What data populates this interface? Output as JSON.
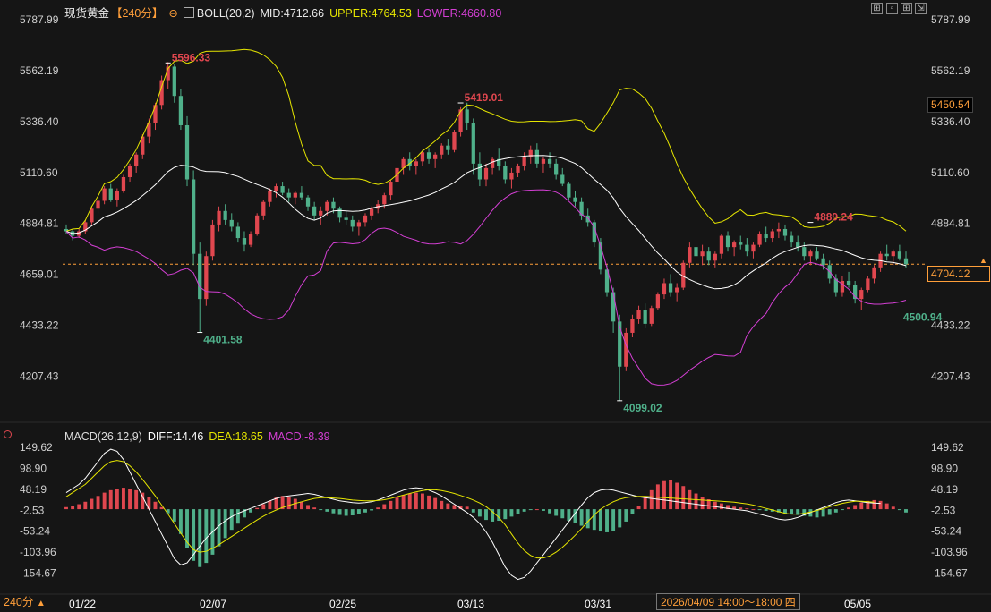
{
  "header": {
    "title": "现货黄金",
    "period": "【240分】",
    "boll_label": "BOLL(20,2)",
    "mid": "MID:4712.66",
    "upper": "UPPER:4764.53",
    "lower": "LOWER:4660.80"
  },
  "macd_header": {
    "label": "MACD(26,12,9)",
    "diff": "DIFF:14.46",
    "dea": "DEA:18.65",
    "macd": "MACD:-8.39"
  },
  "price_tags": {
    "crosshair_price": "5450.54",
    "last_price": "4704.12"
  },
  "bottom_bar": {
    "period": "240分",
    "crosshair_time": "2026/04/09 14:00～18:00 四"
  },
  "colors": {
    "up": "#e0474f",
    "down": "#4fb08a",
    "mid": "#ffffff",
    "upper": "#e6e600",
    "lower": "#d43fd4",
    "dea": "#e6e600",
    "background": "#151515",
    "last_price": "#ff9f3a"
  },
  "chart_data": [
    {
      "type": "candlestick",
      "title": "现货黄金",
      "y_ticks": [
        "5787.99",
        "5562.19",
        "5336.40",
        "5110.60",
        "4884.81",
        "4659.01",
        "4433.22",
        "4207.43"
      ],
      "ylim": [
        4120,
        5830
      ],
      "x_ticks": [
        "01/22",
        "02/07",
        "02/25",
        "03/13",
        "03/31",
        "05/05"
      ],
      "annotations": [
        {
          "text": "5596.33",
          "value": 5596.33,
          "kind": "high"
        },
        {
          "text": "4401.58",
          "value": 4401.58,
          "kind": "low"
        },
        {
          "text": "5419.01",
          "value": 5419.01,
          "kind": "high"
        },
        {
          "text": "4099.02",
          "value": 4099.02,
          "kind": "low"
        },
        {
          "text": "4889.24",
          "value": 4889.24,
          "kind": "high"
        },
        {
          "text": "4500.94",
          "value": 4500.94,
          "kind": "low"
        }
      ],
      "last_price": 4704.12,
      "points": [
        [
          4860,
          4880,
          4840,
          4850
        ],
        [
          4850,
          4860,
          4810,
          4830
        ],
        [
          4830,
          4860,
          4820,
          4850
        ],
        [
          4850,
          4900,
          4840,
          4890
        ],
        [
          4890,
          4960,
          4880,
          4950
        ],
        [
          4950,
          5000,
          4930,
          4985
        ],
        [
          4985,
          5050,
          4970,
          5040
        ],
        [
          5040,
          5060,
          4980,
          4990
        ],
        [
          4990,
          5040,
          4960,
          5030
        ],
        [
          5030,
          5100,
          5020,
          5090
        ],
        [
          5090,
          5150,
          5070,
          5140
        ],
        [
          5140,
          5200,
          5110,
          5190
        ],
        [
          5190,
          5280,
          5170,
          5270
        ],
        [
          5270,
          5350,
          5240,
          5330
        ],
        [
          5330,
          5420,
          5300,
          5410
        ],
        [
          5410,
          5540,
          5390,
          5520
        ],
        [
          5520,
          5600,
          5480,
          5580
        ],
        [
          5580,
          5590,
          5420,
          5450
        ],
        [
          5450,
          5480,
          5300,
          5320
        ],
        [
          5320,
          5360,
          5050,
          5080
        ],
        [
          5080,
          5120,
          4700,
          4750
        ],
        [
          4750,
          4800,
          4400,
          4550
        ],
        [
          4550,
          4760,
          4520,
          4740
        ],
        [
          4740,
          4900,
          4720,
          4880
        ],
        [
          4880,
          4960,
          4850,
          4940
        ],
        [
          4940,
          4970,
          4880,
          4900
        ],
        [
          4900,
          4930,
          4850,
          4870
        ],
        [
          4870,
          4890,
          4800,
          4820
        ],
        [
          4820,
          4850,
          4760,
          4790
        ],
        [
          4790,
          4850,
          4780,
          4840
        ],
        [
          4840,
          4930,
          4830,
          4920
        ],
        [
          4920,
          4990,
          4900,
          4980
        ],
        [
          4980,
          5040,
          4960,
          5030
        ],
        [
          5030,
          5060,
          5000,
          5050
        ],
        [
          5050,
          5070,
          5010,
          5020
        ],
        [
          5020,
          5040,
          4980,
          5000
        ],
        [
          5000,
          5030,
          4970,
          5020
        ],
        [
          5020,
          5050,
          4990,
          5000
        ],
        [
          5000,
          5010,
          4940,
          4960
        ],
        [
          4960,
          4980,
          4900,
          4920
        ],
        [
          4920,
          4960,
          4880,
          4940
        ],
        [
          4940,
          4990,
          4920,
          4980
        ],
        [
          4980,
          5000,
          4930,
          4950
        ],
        [
          4950,
          4960,
          4890,
          4910
        ],
        [
          4910,
          4940,
          4880,
          4900
        ],
        [
          4900,
          4920,
          4850,
          4870
        ],
        [
          4870,
          4900,
          4830,
          4890
        ],
        [
          4890,
          4930,
          4870,
          4920
        ],
        [
          4920,
          4960,
          4900,
          4950
        ],
        [
          4950,
          4990,
          4930,
          4970
        ],
        [
          4970,
          5020,
          4950,
          5010
        ],
        [
          5010,
          5080,
          4990,
          5070
        ],
        [
          5070,
          5140,
          5050,
          5130
        ],
        [
          5130,
          5180,
          5100,
          5170
        ],
        [
          5170,
          5200,
          5120,
          5140
        ],
        [
          5140,
          5170,
          5100,
          5160
        ],
        [
          5160,
          5210,
          5140,
          5200
        ],
        [
          5200,
          5220,
          5150,
          5170
        ],
        [
          5170,
          5200,
          5130,
          5190
        ],
        [
          5190,
          5240,
          5170,
          5230
        ],
        [
          5230,
          5260,
          5190,
          5210
        ],
        [
          5210,
          5300,
          5200,
          5290
        ],
        [
          5290,
          5400,
          5270,
          5390
        ],
        [
          5390,
          5420,
          5300,
          5330
        ],
        [
          5330,
          5350,
          5100,
          5150
        ],
        [
          5150,
          5200,
          5050,
          5080
        ],
        [
          5080,
          5150,
          5050,
          5130
        ],
        [
          5130,
          5180,
          5100,
          5170
        ],
        [
          5170,
          5220,
          5120,
          5140
        ],
        [
          5140,
          5160,
          5060,
          5080
        ],
        [
          5080,
          5130,
          5040,
          5110
        ],
        [
          5110,
          5150,
          5090,
          5140
        ],
        [
          5140,
          5200,
          5120,
          5180
        ],
        [
          5180,
          5230,
          5150,
          5210
        ],
        [
          5210,
          5240,
          5130,
          5150
        ],
        [
          5150,
          5180,
          5110,
          5170
        ],
        [
          5170,
          5200,
          5130,
          5150
        ],
        [
          5150,
          5170,
          5080,
          5100
        ],
        [
          5100,
          5130,
          5050,
          5060
        ],
        [
          5060,
          5070,
          4990,
          5000
        ],
        [
          5000,
          5030,
          4960,
          4980
        ],
        [
          4980,
          5000,
          4900,
          4920
        ],
        [
          4920,
          4950,
          4870,
          4890
        ],
        [
          4890,
          4900,
          4780,
          4800
        ],
        [
          4800,
          4820,
          4660,
          4680
        ],
        [
          4680,
          4700,
          4560,
          4580
        ],
        [
          4580,
          4600,
          4400,
          4450
        ],
        [
          4450,
          4480,
          4099,
          4250
        ],
        [
          4250,
          4420,
          4230,
          4400
        ],
        [
          4400,
          4480,
          4380,
          4460
        ],
        [
          4460,
          4520,
          4440,
          4500
        ],
        [
          4500,
          4530,
          4420,
          4440
        ],
        [
          4440,
          4520,
          4430,
          4510
        ],
        [
          4510,
          4580,
          4500,
          4570
        ],
        [
          4570,
          4640,
          4550,
          4620
        ],
        [
          4620,
          4660,
          4560,
          4580
        ],
        [
          4580,
          4620,
          4540,
          4600
        ],
        [
          4600,
          4720,
          4590,
          4710
        ],
        [
          4710,
          4800,
          4690,
          4780
        ],
        [
          4780,
          4820,
          4720,
          4740
        ],
        [
          4740,
          4790,
          4700,
          4760
        ],
        [
          4760,
          4780,
          4700,
          4720
        ],
        [
          4720,
          4760,
          4690,
          4750
        ],
        [
          4750,
          4840,
          4730,
          4830
        ],
        [
          4830,
          4850,
          4760,
          4780
        ],
        [
          4780,
          4810,
          4740,
          4800
        ],
        [
          4800,
          4830,
          4770,
          4790
        ],
        [
          4790,
          4820,
          4740,
          4760
        ],
        [
          4760,
          4800,
          4730,
          4790
        ],
        [
          4790,
          4850,
          4780,
          4840
        ],
        [
          4840,
          4870,
          4800,
          4820
        ],
        [
          4820,
          4860,
          4800,
          4850
        ],
        [
          4850,
          4889,
          4820,
          4860
        ],
        [
          4860,
          4880,
          4810,
          4830
        ],
        [
          4830,
          4850,
          4780,
          4800
        ],
        [
          4800,
          4830,
          4760,
          4780
        ],
        [
          4780,
          4800,
          4720,
          4740
        ],
        [
          4740,
          4770,
          4700,
          4760
        ],
        [
          4760,
          4780,
          4720,
          4730
        ],
        [
          4730,
          4750,
          4680,
          4700
        ],
        [
          4700,
          4720,
          4620,
          4640
        ],
        [
          4640,
          4660,
          4560,
          4580
        ],
        [
          4580,
          4650,
          4560,
          4630
        ],
        [
          4630,
          4670,
          4600,
          4610
        ],
        [
          4610,
          4630,
          4530,
          4550
        ],
        [
          4550,
          4600,
          4500,
          4590
        ],
        [
          4590,
          4650,
          4580,
          4640
        ],
        [
          4640,
          4700,
          4620,
          4690
        ],
        [
          4690,
          4760,
          4670,
          4750
        ],
        [
          4750,
          4790,
          4720,
          4740
        ],
        [
          4740,
          4770,
          4700,
          4760
        ],
        [
          4760,
          4790,
          4720,
          4730
        ],
        [
          4730,
          4760,
          4690,
          4704
        ]
      ]
    },
    {
      "type": "bar",
      "title": "MACD(26,12,9)",
      "y_ticks": [
        "149.62",
        "98.90",
        "48.19",
        "-2.53",
        "-53.24",
        "-103.96",
        "-154.67"
      ],
      "ylim": [
        -195,
        172
      ],
      "series": [
        {
          "name": "MACD",
          "values": [
            5,
            8,
            12,
            18,
            25,
            32,
            40,
            46,
            50,
            52,
            50,
            46,
            40,
            30,
            18,
            5,
            -10,
            -30,
            -60,
            -95,
            -125,
            -140,
            -130,
            -110,
            -90,
            -70,
            -50,
            -35,
            -20,
            -8,
            3,
            12,
            20,
            28,
            32,
            30,
            25,
            18,
            10,
            4,
            -2,
            -6,
            -10,
            -14,
            -16,
            -15,
            -12,
            -8,
            -3,
            4,
            12,
            20,
            28,
            34,
            38,
            40,
            38,
            33,
            27,
            20,
            14,
            10,
            8,
            6,
            -8,
            -18,
            -26,
            -30,
            -28,
            -24,
            -18,
            -12,
            -6,
            -2,
            0,
            -4,
            -10,
            -16,
            -22,
            -28,
            -34,
            -40,
            -46,
            -50,
            -54,
            -56,
            -52,
            -44,
            -30,
            -12,
            8,
            28,
            46,
            60,
            68,
            70,
            64,
            56,
            46,
            38,
            30,
            24,
            18,
            14,
            10,
            6,
            4,
            2,
            0,
            -2,
            -4,
            -6,
            -8,
            -10,
            -12,
            -14,
            -16,
            -18,
            -20,
            -18,
            -14,
            -8,
            -2,
            4,
            10,
            16,
            20,
            22,
            20,
            14,
            6,
            -2,
            -8
          ]
        },
        {
          "name": "DIFF",
          "values": [
            40,
            50,
            60,
            75,
            95,
            115,
            135,
            145,
            140,
            120,
            90,
            60,
            30,
            0,
            -30,
            -60,
            -90,
            -120,
            -135,
            -130,
            -110,
            -90,
            -70,
            -55,
            -40,
            -28,
            -18,
            -10,
            -4,
            2,
            8,
            14,
            20,
            26,
            30,
            32,
            34,
            36,
            38,
            36,
            32,
            28,
            24,
            20,
            18,
            16,
            15,
            16,
            18,
            22,
            28,
            34,
            40,
            46,
            50,
            52,
            50,
            46,
            40,
            32,
            22,
            12,
            2,
            -8,
            -20,
            -35,
            -55,
            -80,
            -110,
            -140,
            -160,
            -170,
            -165,
            -150,
            -130,
            -110,
            -90,
            -70,
            -50,
            -30,
            -10,
            10,
            28,
            40,
            46,
            48,
            46,
            42,
            38,
            34,
            30,
            28,
            26,
            24,
            22,
            20,
            18,
            16,
            14,
            12,
            10,
            8,
            6,
            4,
            2,
            0,
            -2,
            -4,
            -8,
            -12,
            -16,
            -20,
            -24,
            -26,
            -24,
            -20,
            -14,
            -8,
            -2,
            4,
            10,
            16,
            20,
            22,
            20,
            18,
            16,
            15,
            14
          ]
        },
        {
          "name": "DEA",
          "values": [
            30,
            40,
            50,
            60,
            75,
            90,
            105,
            115,
            118,
            115,
            105,
            90,
            72,
            52,
            32,
            10,
            -12,
            -35,
            -58,
            -80,
            -98,
            -104,
            -102,
            -95,
            -86,
            -76,
            -66,
            -56,
            -46,
            -36,
            -26,
            -17,
            -9,
            -2,
            4,
            9,
            14,
            18,
            22,
            26,
            28,
            28,
            27,
            26,
            24,
            22,
            21,
            20,
            20,
            21,
            23,
            26,
            30,
            34,
            38,
            42,
            45,
            47,
            47,
            45,
            42,
            38,
            33,
            28,
            22,
            15,
            6,
            -6,
            -20,
            -38,
            -60,
            -82,
            -100,
            -112,
            -118,
            -118,
            -113,
            -104,
            -92,
            -78,
            -63,
            -47,
            -30,
            -14,
            0,
            10,
            18,
            24,
            28,
            30,
            31,
            31,
            30,
            29,
            28,
            27,
            26,
            25,
            24,
            23,
            22,
            21,
            20,
            19,
            18,
            17,
            15,
            13,
            10,
            6,
            2,
            -2,
            -6,
            -10,
            -12,
            -12,
            -10,
            -7,
            -3,
            1,
            6,
            10,
            14,
            17,
            19,
            19,
            18,
            17
          ]
        }
      ]
    }
  ]
}
